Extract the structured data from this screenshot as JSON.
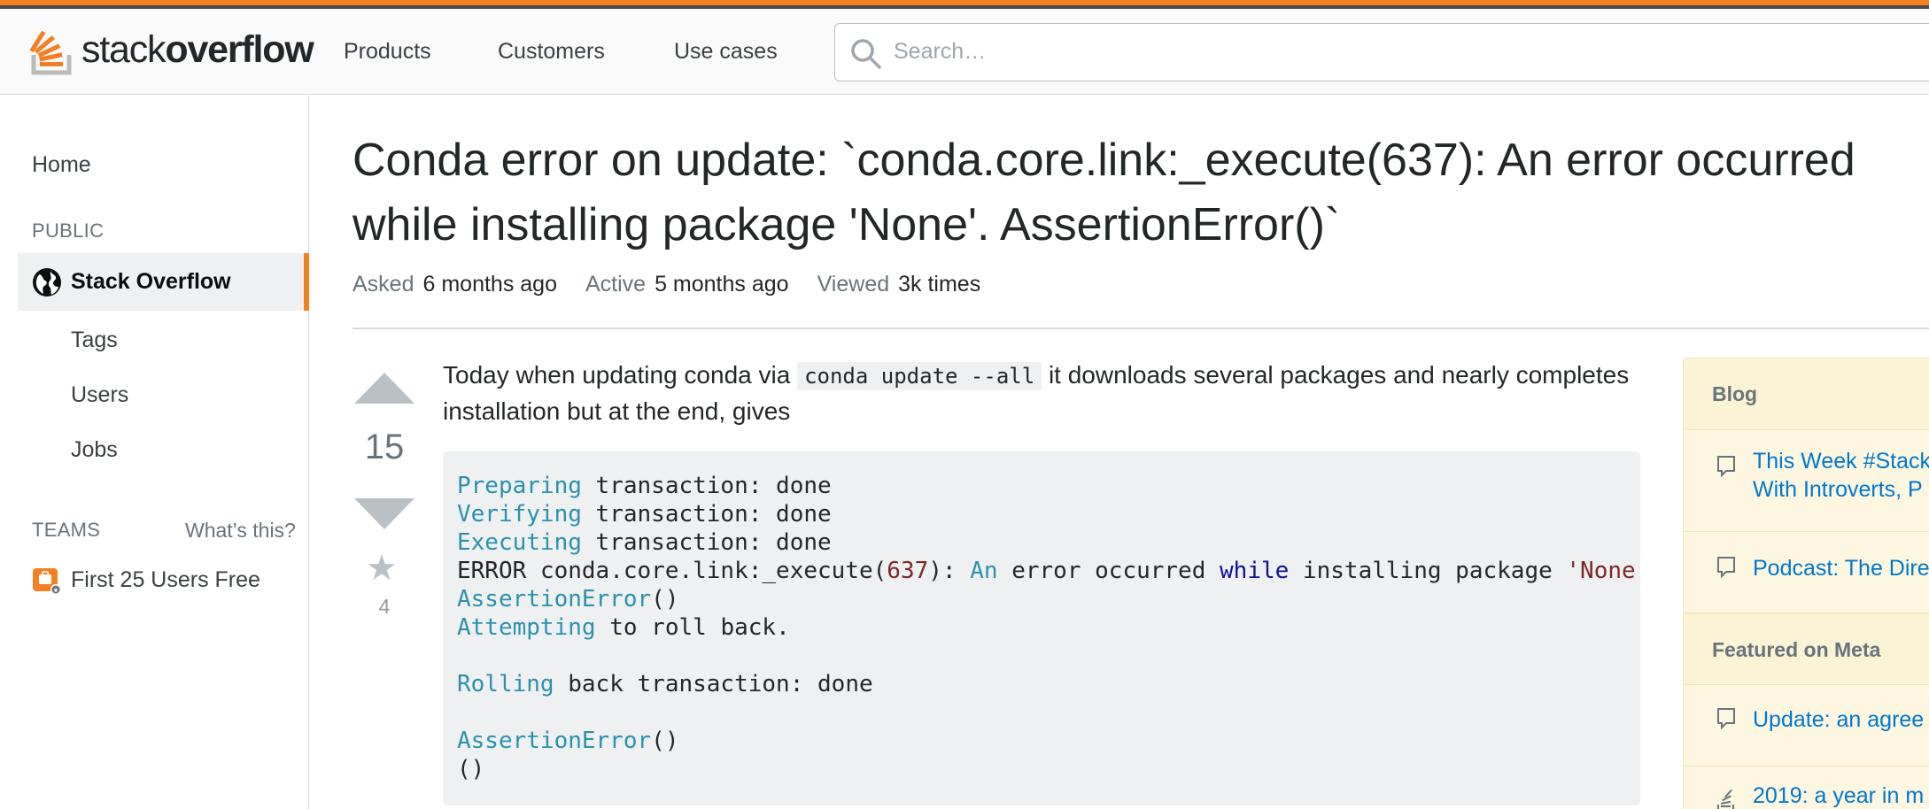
{
  "header": {
    "logo_word_light": "stack",
    "logo_word_bold": "overflow",
    "nav": [
      "Products",
      "Customers",
      "Use cases"
    ],
    "search_placeholder": "Search…",
    "accent_color": "#f48024"
  },
  "sidebar": {
    "home": "Home",
    "public_heading": "PUBLIC",
    "active_item": "Stack Overflow",
    "sub_items": [
      "Tags",
      "Users",
      "Jobs"
    ],
    "teams_heading": "TEAMS",
    "teams_help": "What’s this?",
    "teams_item": "First 25 Users Free"
  },
  "question": {
    "title_line1": "Conda error on update: `conda.core.link:_execute(637): An error occurred",
    "title_line2": "while installing package 'None'. AssertionError()`",
    "asked_label": "Asked",
    "asked_value": "6 months ago",
    "active_label": "Active",
    "active_value": "5 months ago",
    "viewed_label": "Viewed",
    "viewed_value": "3k times",
    "votes": "15",
    "favorites": "4",
    "body_before": "Today when updating conda via ",
    "body_code": "conda update --all",
    "body_after": " it downloads several packages and nearly completes installation but at the end, gives",
    "code_lines": [
      "Preparing transaction: done",
      "Verifying transaction: done",
      "Executing transaction: done",
      "ERROR conda.core.link:_execute(637): An error occurred while installing package 'None",
      "AssertionError()",
      "Attempting to roll back.",
      "",
      "Rolling back transaction: done",
      "",
      "AssertionError()",
      "()"
    ]
  },
  "widget": {
    "blog_heading": "Blog",
    "blog_items": [
      [
        "This Week #Stack",
        "With Introverts, P"
      ],
      [
        "Podcast: The Dire"
      ]
    ],
    "meta_heading": "Featured on Meta",
    "meta_items": [
      "Update: an agree",
      "2019: a year in m"
    ]
  }
}
